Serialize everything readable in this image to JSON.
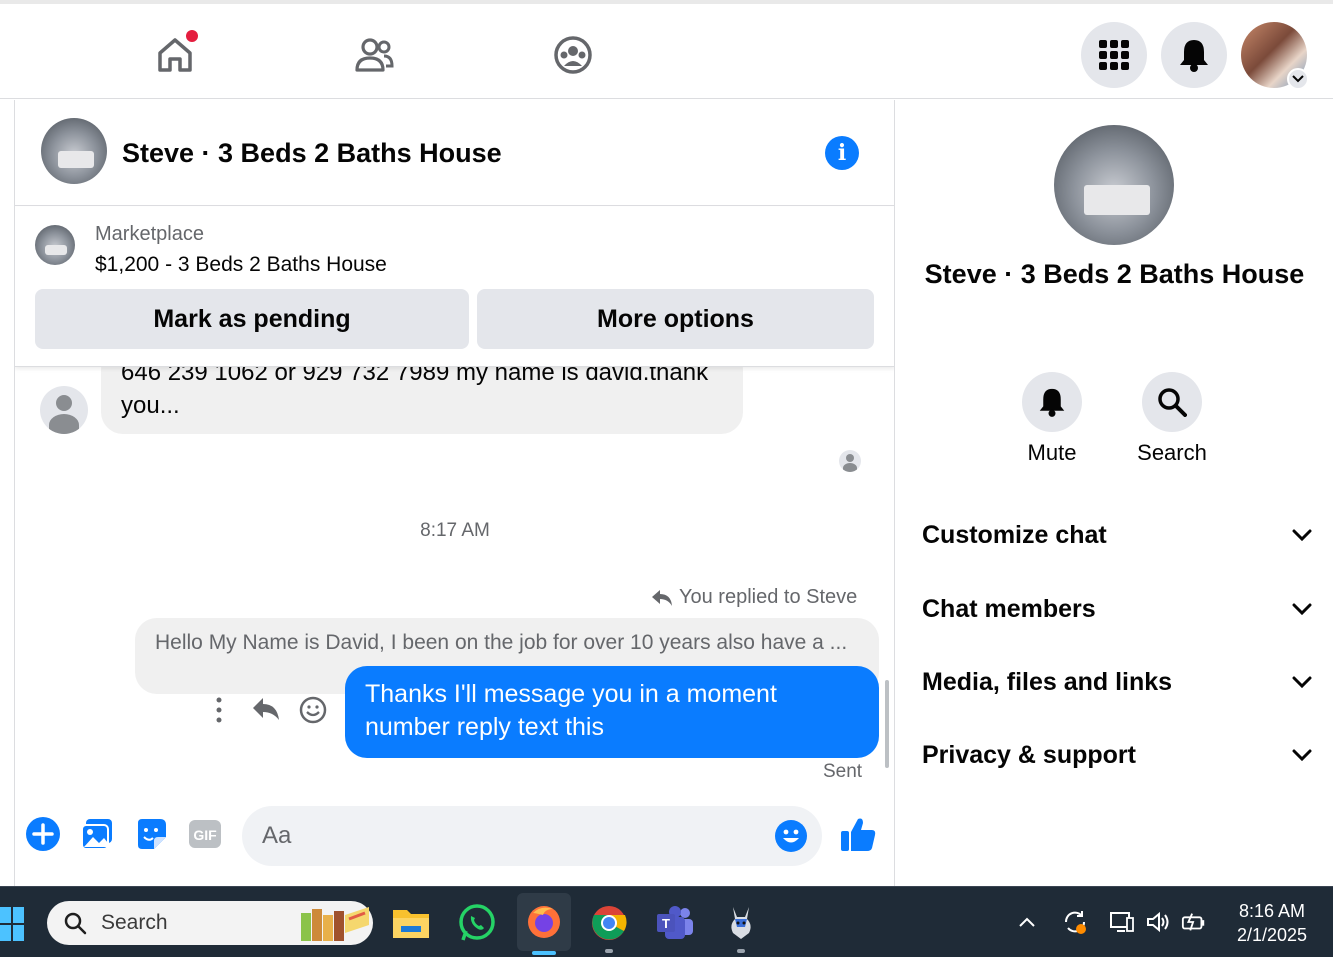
{
  "chat": {
    "title": "Steve · 3 Beds 2 Baths House",
    "marketplace": {
      "label": "Marketplace",
      "listing": "$1,200 - 3 Beds 2 Baths House",
      "mark_pending": "Mark as pending",
      "more_options": "More options"
    },
    "incoming_message": "646 239 1062 or   929 732 7989 my name is david.thank you...",
    "timestamp": "8:17 AM",
    "reply_indicator": "You replied to Steve",
    "quoted_message": "Hello My Name is David, I been on the job for over 10 years also have a ...",
    "outgoing_message": "Thanks I'll message you in a moment number reply text this",
    "status": "Sent",
    "composer_placeholder": "Aa"
  },
  "side": {
    "name": "Steve · 3 Beds 2 Baths House",
    "actions": [
      {
        "label": "Mute",
        "icon": "bell-icon"
      },
      {
        "label": "Search",
        "icon": "search-icon"
      }
    ],
    "sections": [
      "Customize chat",
      "Chat members",
      "Media, files and links",
      "Privacy & support"
    ]
  },
  "taskbar": {
    "search": "Search",
    "time": "8:16 AM",
    "date": "2/1/2025"
  },
  "colors": {
    "accent": "#0a7cff",
    "notification_dot": "#e41e3f",
    "taskbar": "#1f2b37"
  }
}
